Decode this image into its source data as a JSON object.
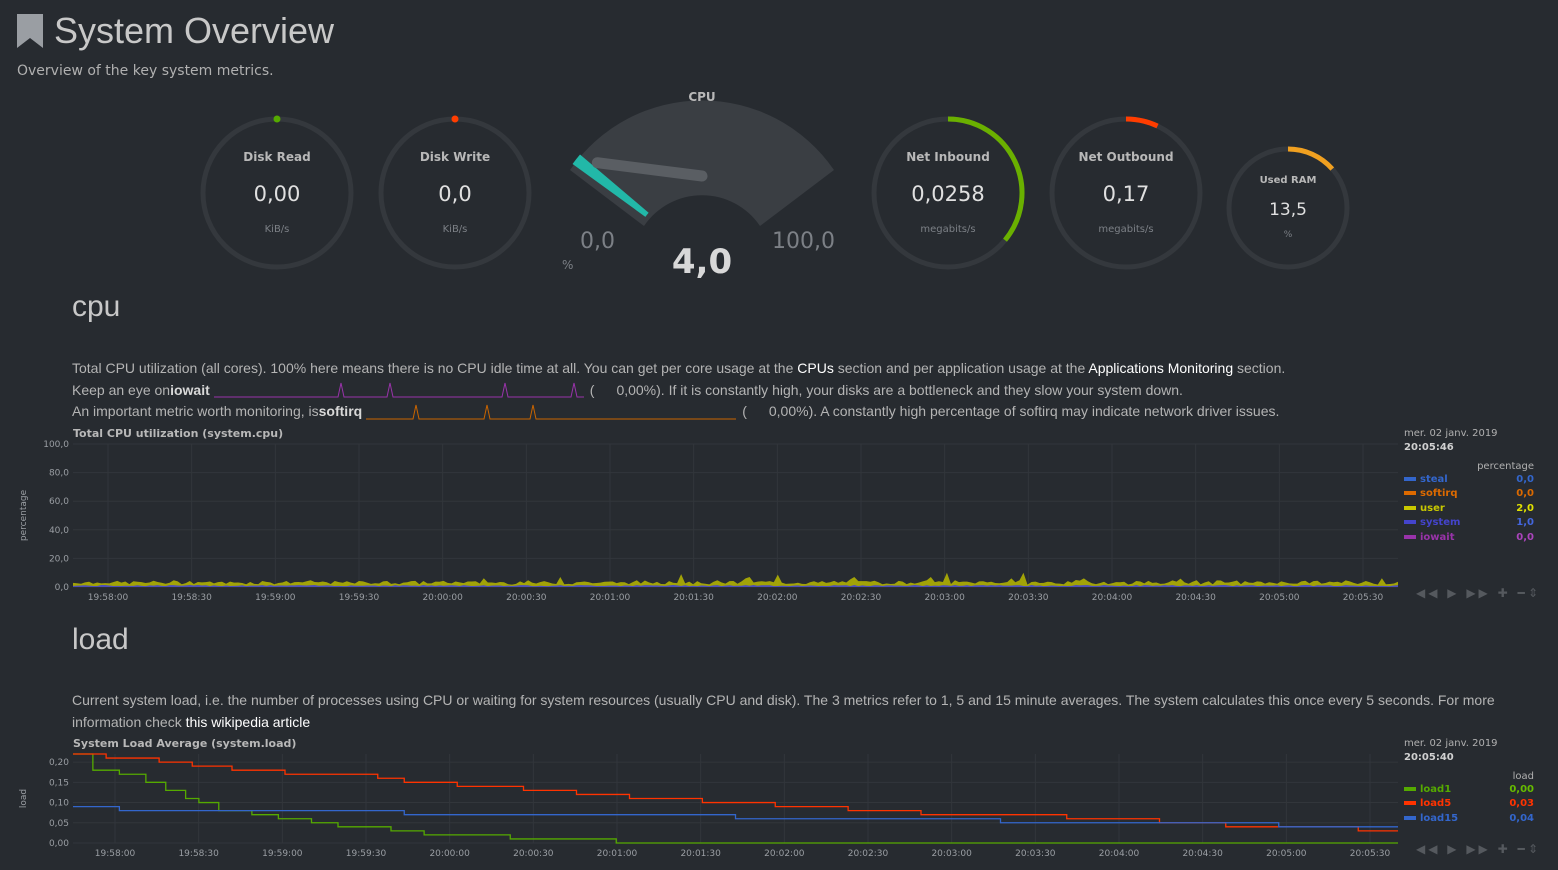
{
  "header": {
    "title": "System Overview",
    "subtitle": "Overview of the key system metrics."
  },
  "gauges": {
    "disk_read": {
      "label": "Disk Read",
      "value": "0,00",
      "unit": "KiB/s",
      "color": "#55aa00",
      "fraction": 0.0
    },
    "disk_write": {
      "label": "Disk Write",
      "value": "0,0",
      "unit": "KiB/s",
      "color": "#ff3d00",
      "fraction": 0.0
    },
    "cpu": {
      "label": "CPU",
      "value": "4,0",
      "min": "0,0",
      "max": "100,0",
      "unit": "%",
      "color": "#22b8a8",
      "percent": 4.0
    },
    "net_inbound": {
      "label": "Net Inbound",
      "value": "0,0258",
      "unit": "megabits/s",
      "color": "#6ab000",
      "fraction": 0.36
    },
    "net_outbound": {
      "label": "Net Outbound",
      "value": "0,17",
      "unit": "megabits/s",
      "color": "#ff3d00",
      "fraction": 0.07
    },
    "used_ram": {
      "label": "Used RAM",
      "value": "13,5",
      "unit": "%",
      "color": "#f0a020",
      "fraction": 0.135
    }
  },
  "cpu_section": {
    "heading": "cpu",
    "p1_a": "Total CPU utilization (all cores). 100% here means there is no CPU idle time at all. You can get per core usage at the ",
    "p1_link1": "CPUs",
    "p1_b": " section and per application usage at the ",
    "p1_link2": "Applications Monitoring",
    "p1_c": " section.",
    "p2_a": "Keep an eye on ",
    "p2_b": "iowait",
    "p2_val": "0,00%",
    "p2_c": "). If it is constantly high, your disks are a bottleneck and they slow your system down.",
    "p3_a": "An important metric worth monitoring, is ",
    "p3_b": "softirq",
    "p3_val": "0,00%",
    "p3_c": "). A constantly high percentage of softirq may indicate network driver issues.",
    "paren_open": "(",
    "chart_title": "Total CPU utilization (system.cpu)",
    "ylabel": "percentage",
    "legend": {
      "date": "mer. 02 janv. 2019",
      "time": "20:05:46",
      "units": "percentage",
      "rows": [
        {
          "name": "steal",
          "value": "0,0",
          "color": "#3366cc",
          "value_color": "#3366cc"
        },
        {
          "name": "softirq",
          "value": "0,0",
          "color": "#dc6a00",
          "value_color": "#dc6a00"
        },
        {
          "name": "user",
          "value": "2,0",
          "color": "#c8c800",
          "value_color": "#e0e000"
        },
        {
          "name": "system",
          "value": "1,0",
          "color": "#4444cc",
          "value_color": "#4466dd"
        },
        {
          "name": "iowait",
          "value": "0,0",
          "color": "#9933aa",
          "value_color": "#aa44bb"
        }
      ]
    }
  },
  "load_section": {
    "heading": "load",
    "p1_a": "Current system load, i.e. the number of processes using CPU or waiting for system resources (usually CPU and disk). The 3 metrics refer to 1, 5 and 15 minute averages. The system calculates this once every 5 seconds. For more information check ",
    "p1_link": "this wikipedia article",
    "chart_title": "System Load Average (system.load)",
    "ylabel": "load",
    "legend": {
      "date": "mer. 02 janv. 2019",
      "time": "20:05:40",
      "units": "load",
      "rows": [
        {
          "name": "load1",
          "value": "0,00",
          "color": "#55aa00",
          "value_color": "#66bb00"
        },
        {
          "name": "load5",
          "value": "0,03",
          "color": "#ff3300",
          "value_color": "#ff3300"
        },
        {
          "name": "load15",
          "value": "0,04",
          "color": "#3366cc",
          "value_color": "#3366cc"
        }
      ]
    }
  },
  "controls": {
    "glyphs": "◀◀ ▶ ▶▶ ✚ ━",
    "resize": "⇕"
  },
  "chart_data": [
    {
      "type": "area",
      "title": "Total CPU utilization (system.cpu)",
      "ylabel": "percentage",
      "ylim": [
        0,
        100
      ],
      "yticks": [
        "0,0",
        "20,0",
        "40,0",
        "60,0",
        "80,0",
        "100,0"
      ],
      "xticks": [
        "19:58:00",
        "19:58:30",
        "19:59:00",
        "19:59:30",
        "20:00:00",
        "20:00:30",
        "20:01:00",
        "20:01:30",
        "20:02:00",
        "20:02:30",
        "20:03:00",
        "20:03:30",
        "20:04:00",
        "20:04:30",
        "20:05:00",
        "20:05:30"
      ],
      "series": [
        {
          "name": "steal",
          "values": [
            0
          ]
        },
        {
          "name": "softirq",
          "values": [
            0
          ]
        },
        {
          "name": "user",
          "values": [
            2,
            3,
            2,
            1,
            3,
            2,
            2,
            4,
            2,
            3,
            2,
            2,
            8,
            2,
            3,
            5,
            3,
            2,
            9,
            3,
            6,
            3,
            4,
            3,
            2,
            3,
            3,
            2,
            2,
            3
          ]
        },
        {
          "name": "system",
          "values": [
            1,
            1,
            1,
            1,
            1,
            1,
            1,
            1,
            1,
            1,
            1,
            1,
            1,
            1,
            1,
            1,
            1,
            1,
            1,
            1,
            1,
            1,
            1,
            1,
            1,
            1,
            1,
            1,
            1,
            1
          ]
        },
        {
          "name": "iowait",
          "values": [
            0
          ]
        }
      ]
    },
    {
      "type": "line",
      "title": "System Load Average (system.load)",
      "ylabel": "load",
      "ylim": [
        0,
        0.22
      ],
      "yticks": [
        "0,00",
        "0,05",
        "0,10",
        "0,15",
        "0,20"
      ],
      "xticks": [
        "19:58:00",
        "19:58:30",
        "19:59:00",
        "19:59:30",
        "20:00:00",
        "20:00:30",
        "20:01:00",
        "20:01:30",
        "20:02:00",
        "20:02:30",
        "20:03:00",
        "20:03:30",
        "20:04:00",
        "20:04:30",
        "20:05:00",
        "20:05:30"
      ],
      "series": [
        {
          "name": "load1",
          "steps": [
            [
              0,
              0.22
            ],
            [
              0.015,
              0.18
            ],
            [
              0.035,
              0.17
            ],
            [
              0.055,
              0.15
            ],
            [
              0.07,
              0.13
            ],
            [
              0.085,
              0.11
            ],
            [
              0.095,
              0.1
            ],
            [
              0.11,
              0.08
            ],
            [
              0.135,
              0.07
            ],
            [
              0.155,
              0.06
            ],
            [
              0.18,
              0.05
            ],
            [
              0.2,
              0.04
            ],
            [
              0.24,
              0.03
            ],
            [
              0.265,
              0.02
            ],
            [
              0.33,
              0.01
            ],
            [
              0.41,
              0.0
            ],
            [
              1.0,
              0.0
            ]
          ]
        },
        {
          "name": "load5",
          "steps": [
            [
              0,
              0.22
            ],
            [
              0.025,
              0.21
            ],
            [
              0.065,
              0.2
            ],
            [
              0.09,
              0.19
            ],
            [
              0.12,
              0.18
            ],
            [
              0.16,
              0.17
            ],
            [
              0.23,
              0.16
            ],
            [
              0.25,
              0.15
            ],
            [
              0.29,
              0.14
            ],
            [
              0.34,
              0.13
            ],
            [
              0.38,
              0.12
            ],
            [
              0.42,
              0.11
            ],
            [
              0.475,
              0.1
            ],
            [
              0.53,
              0.09
            ],
            [
              0.585,
              0.08
            ],
            [
              0.64,
              0.07
            ],
            [
              0.75,
              0.06
            ],
            [
              0.82,
              0.05
            ],
            [
              0.87,
              0.04
            ],
            [
              0.97,
              0.03
            ],
            [
              1.0,
              0.03
            ]
          ]
        },
        {
          "name": "load15",
          "steps": [
            [
              0,
              0.09
            ],
            [
              0.035,
              0.08
            ],
            [
              0.25,
              0.07
            ],
            [
              0.5,
              0.06
            ],
            [
              0.7,
              0.05
            ],
            [
              0.91,
              0.04
            ],
            [
              1.0,
              0.04
            ]
          ]
        }
      ]
    }
  ]
}
